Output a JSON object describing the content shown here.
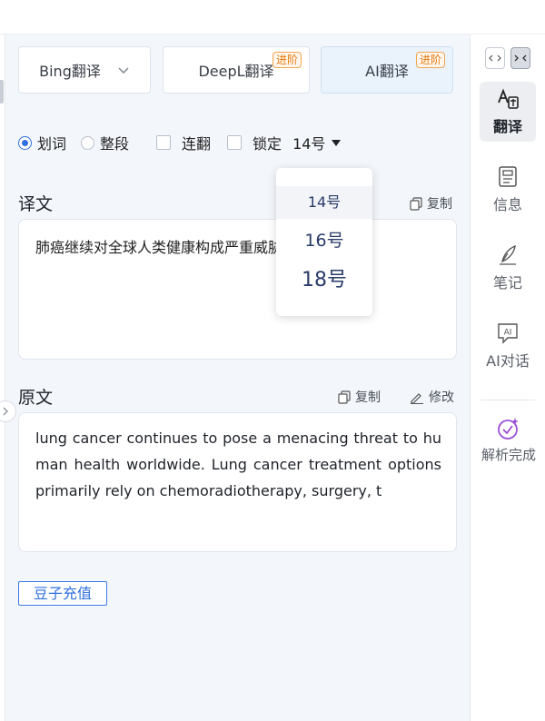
{
  "engines": [
    {
      "label": "Bing翻译",
      "badge": ""
    },
    {
      "label": "DeepL翻译",
      "badge": "进阶"
    },
    {
      "label": "AI翻译",
      "badge": "进阶"
    }
  ],
  "options": {
    "word_mode": "划词",
    "para_mode": "整段",
    "continuous": "连翻",
    "lock": "锁定",
    "font_size": "14号"
  },
  "font_size_options": [
    "14号",
    "16号",
    "18号"
  ],
  "translation": {
    "title": "译文",
    "copy_label": "复制",
    "text": "肺癌继续对全球人类健康构成严重威胁，其治疗"
  },
  "source": {
    "title": "原文",
    "copy_label": "复制",
    "edit_label": "修改",
    "text": "lung cancer continues to pose a menacing threat to human health worldwide. Lung cancer treatment options primarily rely on chemoradiotherapy, surgery, t"
  },
  "recharge_label": "豆子充值",
  "sidebar": {
    "items": [
      {
        "label": "翻译",
        "icon": "translate-icon"
      },
      {
        "label": "信息",
        "icon": "info-document-icon"
      },
      {
        "label": "笔记",
        "icon": "note-pen-icon"
      },
      {
        "label": "AI对话",
        "icon": "ai-chat-icon"
      },
      {
        "label": "解析完成",
        "icon": "parse-complete-icon"
      }
    ]
  },
  "colors": {
    "accent": "#2f6fe0",
    "badge": "#e8780c"
  }
}
